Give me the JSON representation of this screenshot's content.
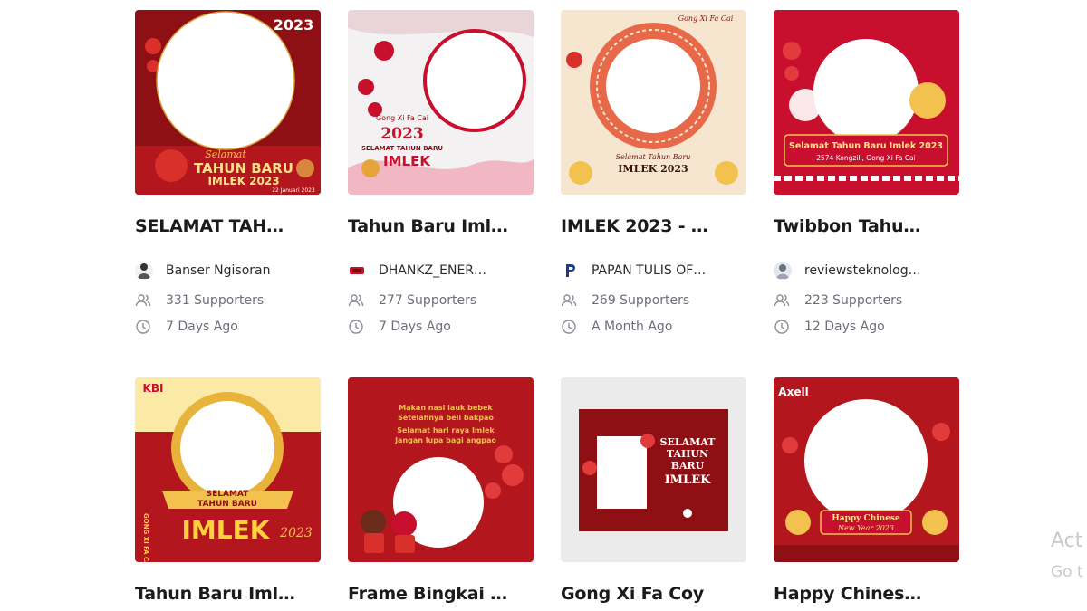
{
  "cards": [
    {
      "title": "SELAMAT TAH…",
      "author": "Banser Ngisoran",
      "supporters": "331 Supporters",
      "time": "7 Days Ago",
      "image": {
        "year": "2023",
        "line1": "Selamat",
        "line2": "TAHUN BARU",
        "line3": "IMLEK 2023",
        "date": "22 Januari 2023"
      }
    },
    {
      "title": "Tahun Baru Iml…",
      "author": "DHANKZ_ENER…",
      "supporters": "277 Supporters",
      "time": "7 Days Ago",
      "image": {
        "line1": "Gong Xi Fa Cai",
        "line2": "2023",
        "line3": "SELAMAT TAHUN BARU",
        "line4": "IMLEK"
      }
    },
    {
      "title": "IMLEK 2023 - …",
      "author": "PAPAN TULIS OF…",
      "supporters": "269 Supporters",
      "time": "A Month Ago",
      "image": {
        "line1": "Gong Xi Fa Cai",
        "line2": "Selamat Tahun Baru",
        "line3": "IMLEK 2023"
      }
    },
    {
      "title": "Twibbon Tahu…",
      "author": "reviewsteknolog…",
      "supporters": "223 Supporters",
      "time": "12 Days Ago",
      "image": {
        "line1": "Selamat Tahun Baru Imlek 2023",
        "line2": "2574 Kongzili, Gong Xi Fa Cai"
      }
    },
    {
      "title": "Tahun Baru Iml…",
      "image": {
        "brand": "KBI",
        "line1": "SELAMAT",
        "line2": "TAHUN BARU",
        "line3": "IMLEK",
        "year": "2023",
        "side": "GONG XI FA CAI"
      }
    },
    {
      "title": "Frame Bingkai …",
      "image": {
        "line1": "Makan nasi lauk bebek",
        "line2": "Setelahnya beli bakpao",
        "line3": "Selamat hari raya Imlek",
        "line4": "Jangan lupa bagi angpao"
      }
    },
    {
      "title": "Gong Xi Fa Coy",
      "image": {
        "line1": "SELAMAT",
        "line2": "TAHUN",
        "line3": "BARU",
        "line4": "IMLEK"
      }
    },
    {
      "title": "Happy Chines…",
      "image": {
        "brand": "Axell",
        "line1": "Happy Chinese",
        "line2": "New Year 2023"
      }
    }
  ],
  "watermark": {
    "line1": "Act",
    "line2": "Go t"
  },
  "colors": {
    "deep_red": "#9e1418",
    "red": "#c8102e",
    "gold": "#f2c14e",
    "cream": "#f6e3c8",
    "muted_text": "#6b6f78"
  },
  "icons": {
    "supporters": "users-icon",
    "time": "clock-icon"
  }
}
